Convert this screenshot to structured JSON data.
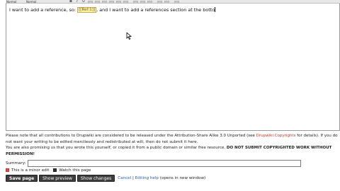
{
  "toolbar": {
    "format_select": "Normal",
    "font_select": "Normal",
    "bold_icon": "B",
    "italic_icon": "I",
    "underline_icon": "U"
  },
  "editor": {
    "text_before": "I want to add a reference, so: ",
    "reference_label": "[[Ref:1]]",
    "text_after": ", and I want to add a references section at the botto"
  },
  "notice": {
    "line1_a": "Please note that all contributions to Drupwiki are considered to be released under the Attribution-Share Alike 3.0 Unported (see ",
    "line1_link": "Drupwiki:Copyrights",
    "line1_b": " for details). If you do not want your writing to be edited mercilessly and redistributed at will, then do not submit it here.",
    "line2_a": "You are also promising us that you wrote this yourself, or copied it from a public domain or similar free resource. ",
    "line2_bold": "DO NOT SUBMIT COPYRIGHTED WORK WITHOUT PERMISSION!"
  },
  "summary": {
    "label": "Summary:",
    "value": ""
  },
  "checks": {
    "minor_edit": "This is a minor edit",
    "watch": "Watch this page"
  },
  "buttons": {
    "save": "Save page",
    "preview": "Show preview",
    "changes": "Show changes"
  },
  "links": {
    "cancel": "Cancel",
    "separator": " | ",
    "help": "Editing help",
    "help_note": " (opens in new window)"
  },
  "colors": {
    "button_bg": "#3d3d3d",
    "link": "#2a5db0",
    "copyright_link": "#c0392b",
    "reference_chip": "#fff3b0"
  }
}
